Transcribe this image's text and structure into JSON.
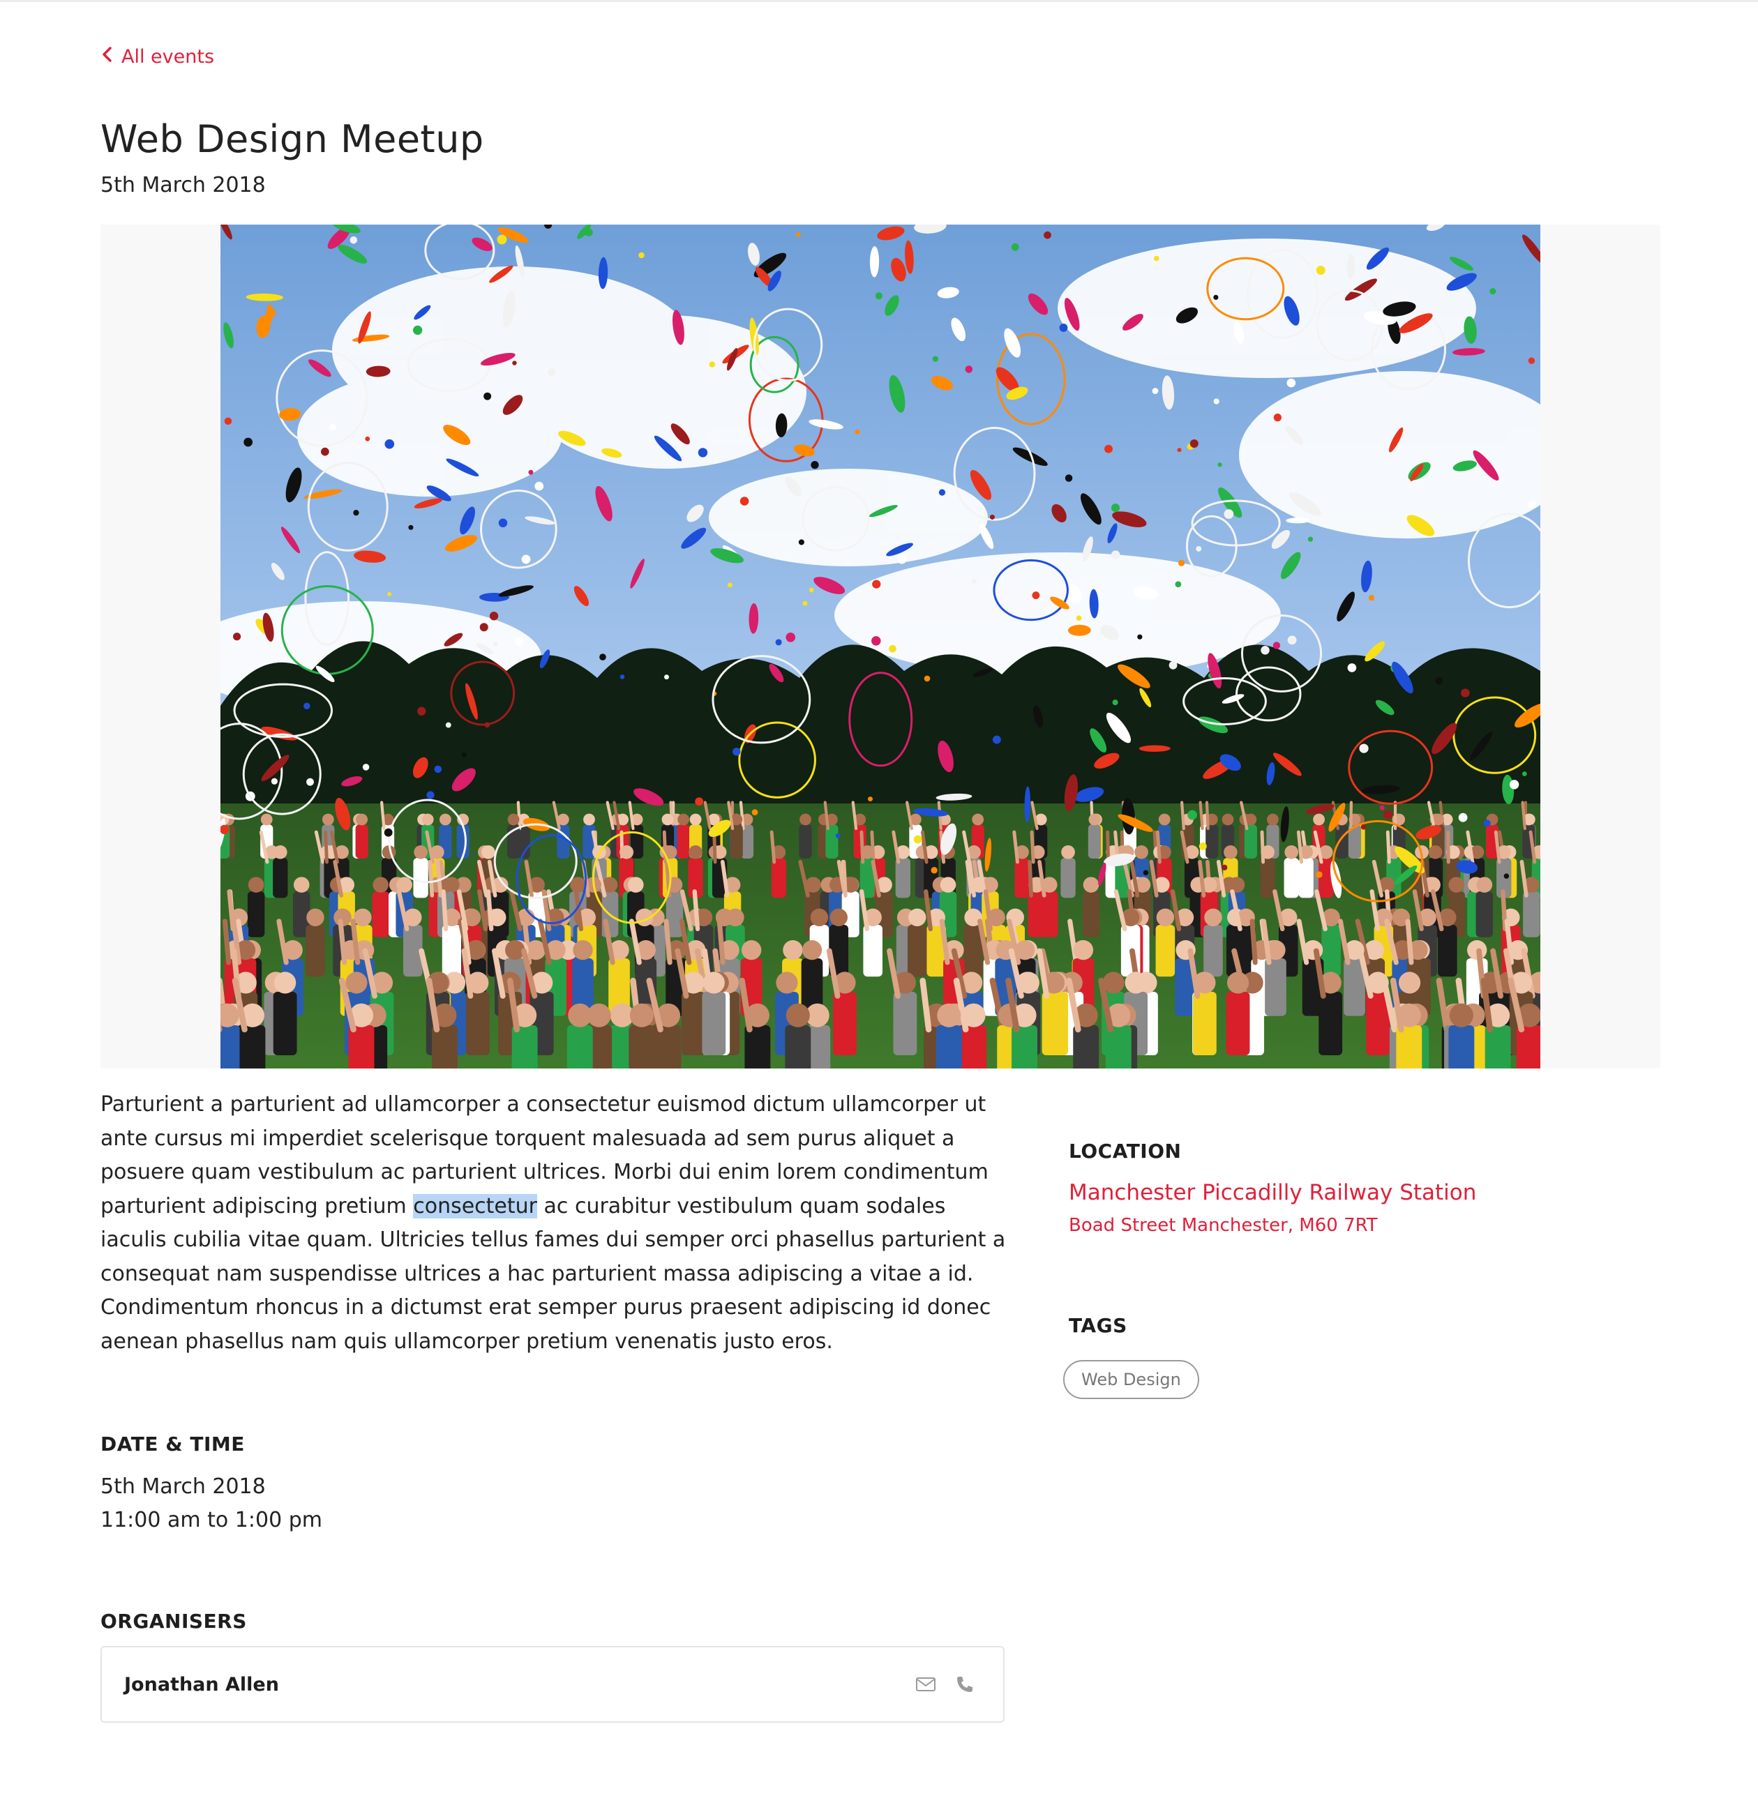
{
  "nav": {
    "back_label": "All events"
  },
  "event": {
    "title": "Web Design Meetup",
    "date": "5th March 2018",
    "description_parts": [
      "Parturient a parturient ad ullamcorper a consectetur euismod dictum ullamcorper ut ante cursus mi imperdiet scelerisque torquent malesuada ad sem purus aliquet a posuere quam vestibulum ac parturient ultrices. Morbi dui enim lorem condimentum parturient adipiscing pretium ",
      "consectetur",
      " ac curabitur vestibulum quam sodales iaculis cubilia vitae quam. Ultricies tellus fames dui semper orci phasellus parturient a consequat nam suspendisse ultrices a hac parturient massa adipiscing a vitae a id. Condimentum rhoncus in a dictumst erat semper purus praesent adipiscing id donec aenean phasellus nam quis ullamcorper pretium venenatis justo eros."
    ]
  },
  "datetime": {
    "heading": "DATE & TIME",
    "date": "5th March 2018",
    "time": "11:00 am to 1:00 pm"
  },
  "organisers": {
    "heading": "ORGANISERS",
    "items": [
      {
        "name": "Jonathan Allen"
      }
    ]
  },
  "location": {
    "heading": "LOCATION",
    "name": "Manchester Piccadilly Railway Station",
    "address": "Boad Street Manchester, M60 7RT"
  },
  "tags": {
    "heading": "TAGS",
    "items": [
      "Web Design"
    ]
  },
  "icons": {
    "back": "chevron-left-icon",
    "email": "envelope-icon",
    "phone": "phone-icon"
  },
  "colors": {
    "accent": "#e0203a",
    "text": "#222222",
    "selection": "#b8d5f5"
  }
}
